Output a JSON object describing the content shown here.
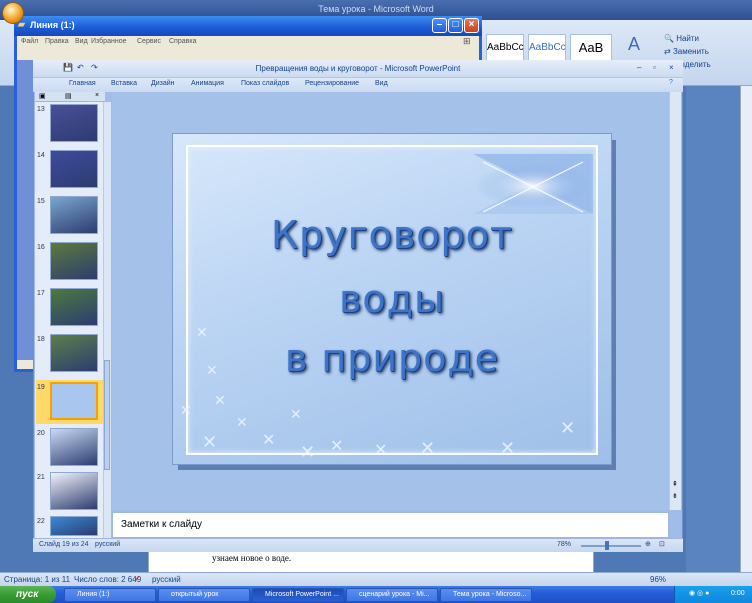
{
  "word": {
    "title": "Тема урока - Microsoft Word",
    "styles": [
      "AaBbCc",
      "AaBbCc",
      "AaB"
    ],
    "editing": {
      "find": "Найти",
      "replace": "Заменить",
      "select": "Выделить"
    },
    "doc_text": "узнаем новое о воде.",
    "status": {
      "page": "Страница: 1 из 11",
      "words": "Число слов: 2 649",
      "lang": "русский",
      "zoom": "96%"
    }
  },
  "explorer": {
    "title": "Линия (1:)",
    "menu": [
      "Файл",
      "Правка",
      "Вид",
      "Избранное",
      "Сервис",
      "Справка"
    ]
  },
  "powerpoint": {
    "title": "Превращения воды и круговорот - Microsoft PowerPoint",
    "tabs": [
      "Главная",
      "Вставка",
      "Дизайн",
      "Анимация",
      "Показ слайдов",
      "Рецензирование",
      "Вид"
    ],
    "slides": [
      {
        "num": "13",
        "color": "#4a4f9a"
      },
      {
        "num": "14",
        "color": "#3e4b9e"
      },
      {
        "num": "15",
        "color": "#7aa6cf"
      },
      {
        "num": "16",
        "color": "#5b7b3a"
      },
      {
        "num": "17",
        "color": "#4c7a3f"
      },
      {
        "num": "18",
        "color": "#5c7f4a"
      },
      {
        "num": "19",
        "color": "#a8c6ee"
      },
      {
        "num": "20",
        "color": "#c9dbf3"
      },
      {
        "num": "21",
        "color": "#f3f3fb"
      },
      {
        "num": "22",
        "color": "#3a8ad8"
      }
    ],
    "selected_slide": "19",
    "slide_title_lines": [
      "Круговорот",
      "воды",
      "в природе"
    ],
    "notes_placeholder": "Заметки к слайду",
    "status": {
      "slide": "Слайд 19 из 24",
      "lang": "русский",
      "zoom": "78%"
    }
  },
  "taskbar": {
    "start": "пуск",
    "items": [
      "Линия (1:)",
      "открытый урок",
      "Microsoft PowerPoint ...",
      "сценарий урока - Mi...",
      "Тема урока - Microso..."
    ],
    "lang": "RU",
    "time": "0:00"
  }
}
